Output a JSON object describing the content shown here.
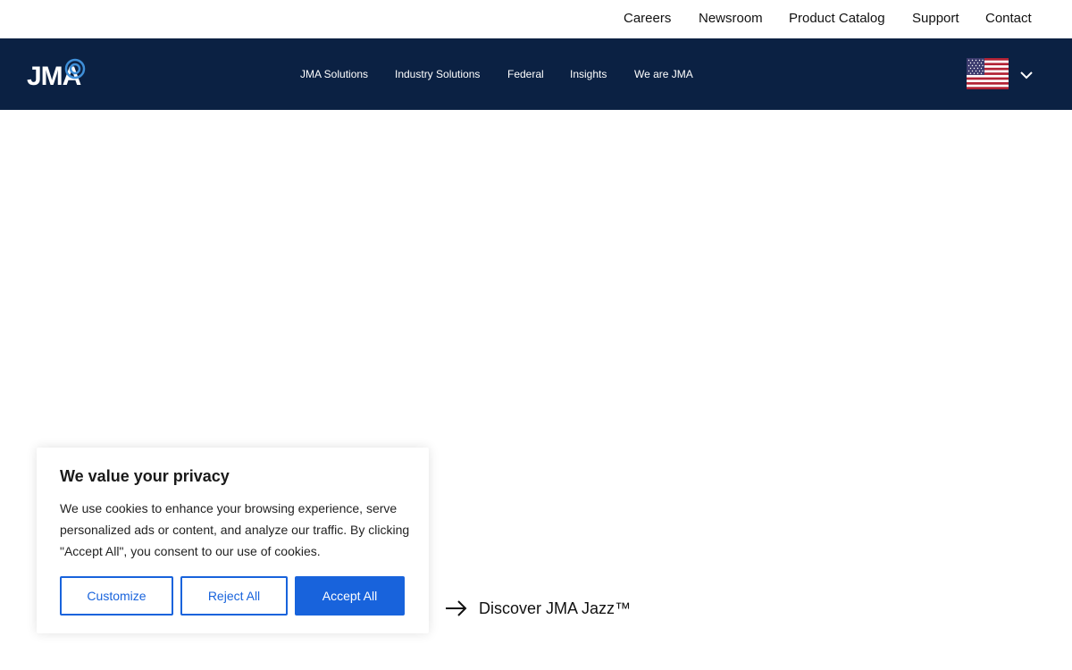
{
  "utility_nav": {
    "items": [
      "Careers",
      "Newsroom",
      "Product Catalog",
      "Support",
      "Contact"
    ]
  },
  "header": {
    "logo_text": "JMA",
    "nav_items": [
      "JMA Solutions",
      "Industry Solutions",
      "Federal",
      "Insights",
      "We are JMA"
    ],
    "region_selector": {
      "flag": "us-flag-icon",
      "dropdown_icon": "chevron-down-icon"
    }
  },
  "hero": {
    "cta_label": "Discover JMA Jazz™",
    "cta_icon": "arrow-right-icon"
  },
  "cookie_banner": {
    "title": "We value your privacy",
    "text": "We use cookies to enhance your browsing experience, serve personalized ads or content, and analyze our traffic. By clicking \"Accept All\", you consent to our use of cookies.",
    "customize_label": "Customize",
    "reject_label": "Reject All",
    "accept_label": "Accept All"
  },
  "colors": {
    "nav_background": "#0b2143",
    "logo_accent": "#3f8fd8",
    "button_blue": "#1863dc"
  }
}
